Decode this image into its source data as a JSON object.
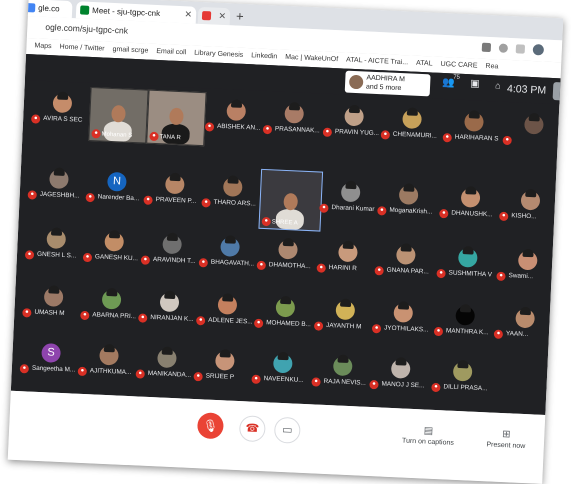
{
  "browser": {
    "tab_first_partial": "gle.co",
    "tab_active_title": "Meet - sju-tgpc-cnk",
    "tab_youtube_partial": "",
    "new_tab": "+",
    "url": "ogle.com/sju-tgpc-cnk",
    "bookmarks": [
      "Maps",
      "Home / Twitter",
      "gmail scrge",
      "Email coll",
      "Library Genesis",
      "Linkedin",
      "Mac | WakeUnOf",
      "ATAL - AICTE Trai...",
      "ATAL",
      "UGC CARE",
      "Rea"
    ]
  },
  "meet": {
    "presenter_line1": "AADHIRA M",
    "presenter_line2": "and 5 more",
    "people_count": "75",
    "time": "4:03 PM",
    "tiles": [
      {
        "name": "AVIRA S SEC",
        "kind": "face",
        "color": "#c58c6a"
      },
      {
        "name": "Mohanan S",
        "kind": "video"
      },
      {
        "name": "TANA R",
        "kind": "video2"
      },
      {
        "name": "ABISHEK AN...",
        "kind": "face",
        "color": "#b98064"
      },
      {
        "name": "PRASANNAK...",
        "kind": "face",
        "color": "#a87b66"
      },
      {
        "name": "PRAVIN YUG...",
        "kind": "face",
        "color": "#bfa088"
      },
      {
        "name": "CHENAMURI...",
        "kind": "face",
        "color": "#c7a15a"
      },
      {
        "name": "HARIHARAN S",
        "kind": "face",
        "color": "#9a6a4a"
      },
      {
        "name": "",
        "kind": "face",
        "color": "#6c5448"
      },
      {
        "name": "JAGESHBH...",
        "kind": "face",
        "color": "#8d7a6e"
      },
      {
        "name": "Narender Ba...",
        "kind": "letter",
        "letter": "N",
        "color": "#1565c0"
      },
      {
        "name": "PRAVEEN P...",
        "kind": "face",
        "color": "#b78666"
      },
      {
        "name": "THARO ARS...",
        "kind": "face",
        "color": "#a17658"
      },
      {
        "name": "SHREE A",
        "kind": "video3"
      },
      {
        "name": "Dharani Kumar",
        "kind": "face",
        "color": "#8f8f8f"
      },
      {
        "name": "MoganaKrish...",
        "kind": "face",
        "color": "#9c7a62"
      },
      {
        "name": "DHANUSHK...",
        "kind": "face",
        "color": "#c49070"
      },
      {
        "name": "KISHO...",
        "kind": "face",
        "color": "#b58a70"
      },
      {
        "name": "GNESH L S...",
        "kind": "face",
        "color": "#a88c6c"
      },
      {
        "name": "GANESH KU...",
        "kind": "face",
        "color": "#c28d66"
      },
      {
        "name": "ARAVINDH T...",
        "kind": "face",
        "color": "#6f6f6f"
      },
      {
        "name": "BHAGAVATH...",
        "kind": "face",
        "color": "#4f7aa8"
      },
      {
        "name": "DHAMOTHA...",
        "kind": "face",
        "color": "#ad8870"
      },
      {
        "name": "HARINI R",
        "kind": "face",
        "color": "#c89a7c"
      },
      {
        "name": "GNANA PAR...",
        "kind": "face",
        "color": "#bb9274"
      },
      {
        "name": "SUSHMITHA V",
        "kind": "face",
        "color": "#35a7a2"
      },
      {
        "name": "Swami...",
        "kind": "face",
        "color": "#c98f74"
      },
      {
        "name": "UMASH M",
        "kind": "face",
        "color": "#9c7966"
      },
      {
        "name": "ABARNA PRI...",
        "kind": "face",
        "color": "#6e9a54"
      },
      {
        "name": "NIRANJAN K...",
        "kind": "face",
        "color": "#cfc7bf"
      },
      {
        "name": "ADLENE JES...",
        "kind": "face",
        "color": "#c4805e"
      },
      {
        "name": "MOHAMED B...",
        "kind": "face",
        "color": "#7c9b4e"
      },
      {
        "name": "JAYANTH M",
        "kind": "face",
        "color": "#d1b257"
      },
      {
        "name": "JYOTHILAKS...",
        "kind": "face",
        "color": "#c99272"
      },
      {
        "name": "MANTHRA K...",
        "kind": "face",
        "color": "#050505"
      },
      {
        "name": "YAAN...",
        "kind": "face",
        "color": "#b98b6c"
      },
      {
        "name": "Sangeetha M...",
        "kind": "letter",
        "letter": "S",
        "color": "#8e44ad"
      },
      {
        "name": "AJITHKUMA...",
        "kind": "face",
        "color": "#a37a60"
      },
      {
        "name": "MANIKANDA...",
        "kind": "face",
        "color": "#888070"
      },
      {
        "name": "SRIJEE P",
        "kind": "face",
        "color": "#c79478"
      },
      {
        "name": "NAVEENKU...",
        "kind": "face",
        "color": "#40a3b0"
      },
      {
        "name": "RAJA NEVIS...",
        "kind": "face",
        "color": "#6b8c5a"
      },
      {
        "name": "MANOJ J SE...",
        "kind": "face",
        "color": "#bfb4ac"
      },
      {
        "name": "DILLI PRASA...",
        "kind": "face",
        "color": "#9f9a60"
      }
    ]
  },
  "controls": {
    "captions_label": "Turn on captions",
    "present_label": "Present now"
  }
}
